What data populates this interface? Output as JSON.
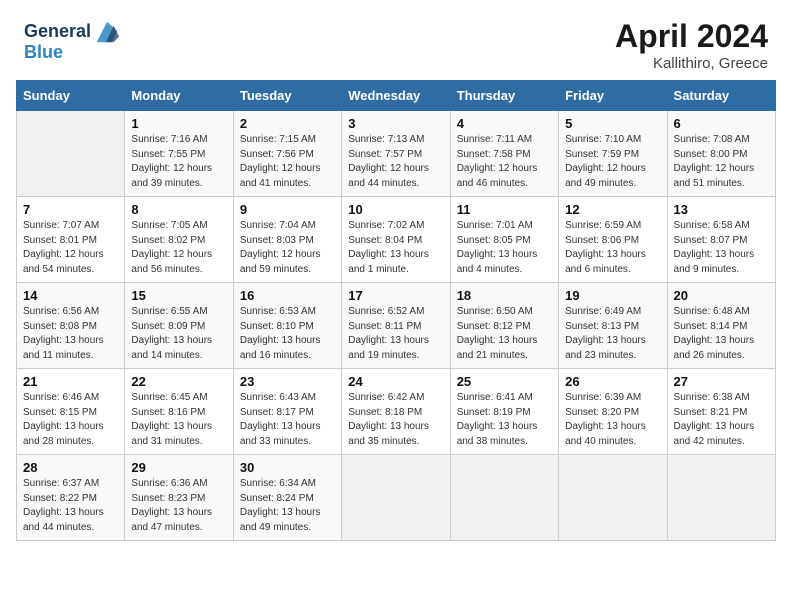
{
  "header": {
    "logo_line1": "General",
    "logo_line2": "Blue",
    "month_year": "April 2024",
    "location": "Kallithiro, Greece"
  },
  "days_of_week": [
    "Sunday",
    "Monday",
    "Tuesday",
    "Wednesday",
    "Thursday",
    "Friday",
    "Saturday"
  ],
  "weeks": [
    [
      {
        "day": "",
        "sunrise": "",
        "sunset": "",
        "daylight": ""
      },
      {
        "day": "1",
        "sunrise": "Sunrise: 7:16 AM",
        "sunset": "Sunset: 7:55 PM",
        "daylight": "Daylight: 12 hours and 39 minutes."
      },
      {
        "day": "2",
        "sunrise": "Sunrise: 7:15 AM",
        "sunset": "Sunset: 7:56 PM",
        "daylight": "Daylight: 12 hours and 41 minutes."
      },
      {
        "day": "3",
        "sunrise": "Sunrise: 7:13 AM",
        "sunset": "Sunset: 7:57 PM",
        "daylight": "Daylight: 12 hours and 44 minutes."
      },
      {
        "day": "4",
        "sunrise": "Sunrise: 7:11 AM",
        "sunset": "Sunset: 7:58 PM",
        "daylight": "Daylight: 12 hours and 46 minutes."
      },
      {
        "day": "5",
        "sunrise": "Sunrise: 7:10 AM",
        "sunset": "Sunset: 7:59 PM",
        "daylight": "Daylight: 12 hours and 49 minutes."
      },
      {
        "day": "6",
        "sunrise": "Sunrise: 7:08 AM",
        "sunset": "Sunset: 8:00 PM",
        "daylight": "Daylight: 12 hours and 51 minutes."
      }
    ],
    [
      {
        "day": "7",
        "sunrise": "Sunrise: 7:07 AM",
        "sunset": "Sunset: 8:01 PM",
        "daylight": "Daylight: 12 hours and 54 minutes."
      },
      {
        "day": "8",
        "sunrise": "Sunrise: 7:05 AM",
        "sunset": "Sunset: 8:02 PM",
        "daylight": "Daylight: 12 hours and 56 minutes."
      },
      {
        "day": "9",
        "sunrise": "Sunrise: 7:04 AM",
        "sunset": "Sunset: 8:03 PM",
        "daylight": "Daylight: 12 hours and 59 minutes."
      },
      {
        "day": "10",
        "sunrise": "Sunrise: 7:02 AM",
        "sunset": "Sunset: 8:04 PM",
        "daylight": "Daylight: 13 hours and 1 minute."
      },
      {
        "day": "11",
        "sunrise": "Sunrise: 7:01 AM",
        "sunset": "Sunset: 8:05 PM",
        "daylight": "Daylight: 13 hours and 4 minutes."
      },
      {
        "day": "12",
        "sunrise": "Sunrise: 6:59 AM",
        "sunset": "Sunset: 8:06 PM",
        "daylight": "Daylight: 13 hours and 6 minutes."
      },
      {
        "day": "13",
        "sunrise": "Sunrise: 6:58 AM",
        "sunset": "Sunset: 8:07 PM",
        "daylight": "Daylight: 13 hours and 9 minutes."
      }
    ],
    [
      {
        "day": "14",
        "sunrise": "Sunrise: 6:56 AM",
        "sunset": "Sunset: 8:08 PM",
        "daylight": "Daylight: 13 hours and 11 minutes."
      },
      {
        "day": "15",
        "sunrise": "Sunrise: 6:55 AM",
        "sunset": "Sunset: 8:09 PM",
        "daylight": "Daylight: 13 hours and 14 minutes."
      },
      {
        "day": "16",
        "sunrise": "Sunrise: 6:53 AM",
        "sunset": "Sunset: 8:10 PM",
        "daylight": "Daylight: 13 hours and 16 minutes."
      },
      {
        "day": "17",
        "sunrise": "Sunrise: 6:52 AM",
        "sunset": "Sunset: 8:11 PM",
        "daylight": "Daylight: 13 hours and 19 minutes."
      },
      {
        "day": "18",
        "sunrise": "Sunrise: 6:50 AM",
        "sunset": "Sunset: 8:12 PM",
        "daylight": "Daylight: 13 hours and 21 minutes."
      },
      {
        "day": "19",
        "sunrise": "Sunrise: 6:49 AM",
        "sunset": "Sunset: 8:13 PM",
        "daylight": "Daylight: 13 hours and 23 minutes."
      },
      {
        "day": "20",
        "sunrise": "Sunrise: 6:48 AM",
        "sunset": "Sunset: 8:14 PM",
        "daylight": "Daylight: 13 hours and 26 minutes."
      }
    ],
    [
      {
        "day": "21",
        "sunrise": "Sunrise: 6:46 AM",
        "sunset": "Sunset: 8:15 PM",
        "daylight": "Daylight: 13 hours and 28 minutes."
      },
      {
        "day": "22",
        "sunrise": "Sunrise: 6:45 AM",
        "sunset": "Sunset: 8:16 PM",
        "daylight": "Daylight: 13 hours and 31 minutes."
      },
      {
        "day": "23",
        "sunrise": "Sunrise: 6:43 AM",
        "sunset": "Sunset: 8:17 PM",
        "daylight": "Daylight: 13 hours and 33 minutes."
      },
      {
        "day": "24",
        "sunrise": "Sunrise: 6:42 AM",
        "sunset": "Sunset: 8:18 PM",
        "daylight": "Daylight: 13 hours and 35 minutes."
      },
      {
        "day": "25",
        "sunrise": "Sunrise: 6:41 AM",
        "sunset": "Sunset: 8:19 PM",
        "daylight": "Daylight: 13 hours and 38 minutes."
      },
      {
        "day": "26",
        "sunrise": "Sunrise: 6:39 AM",
        "sunset": "Sunset: 8:20 PM",
        "daylight": "Daylight: 13 hours and 40 minutes."
      },
      {
        "day": "27",
        "sunrise": "Sunrise: 6:38 AM",
        "sunset": "Sunset: 8:21 PM",
        "daylight": "Daylight: 13 hours and 42 minutes."
      }
    ],
    [
      {
        "day": "28",
        "sunrise": "Sunrise: 6:37 AM",
        "sunset": "Sunset: 8:22 PM",
        "daylight": "Daylight: 13 hours and 44 minutes."
      },
      {
        "day": "29",
        "sunrise": "Sunrise: 6:36 AM",
        "sunset": "Sunset: 8:23 PM",
        "daylight": "Daylight: 13 hours and 47 minutes."
      },
      {
        "day": "30",
        "sunrise": "Sunrise: 6:34 AM",
        "sunset": "Sunset: 8:24 PM",
        "daylight": "Daylight: 13 hours and 49 minutes."
      },
      {
        "day": "",
        "sunrise": "",
        "sunset": "",
        "daylight": ""
      },
      {
        "day": "",
        "sunrise": "",
        "sunset": "",
        "daylight": ""
      },
      {
        "day": "",
        "sunrise": "",
        "sunset": "",
        "daylight": ""
      },
      {
        "day": "",
        "sunrise": "",
        "sunset": "",
        "daylight": ""
      }
    ]
  ]
}
